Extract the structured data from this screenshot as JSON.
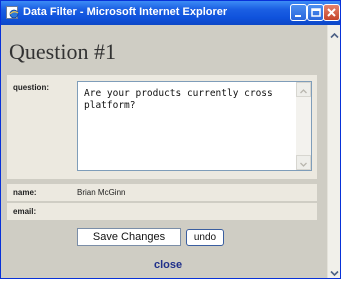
{
  "window": {
    "title": "Data Filter - Microsoft Internet Explorer",
    "icon": "ie-page-icon"
  },
  "page": {
    "heading": "Question #1"
  },
  "form": {
    "question_label": "question:",
    "question_value": "Are your products currently cross platform?",
    "name_label": "name:",
    "name_value": "Brian McGinn",
    "email_label": "email:",
    "email_value": ""
  },
  "actions": {
    "save_label": "Save Changes",
    "undo_label": "undo",
    "close_label": "close"
  },
  "colors": {
    "titlebar": "#0f52dc",
    "content_bg": "#cfcdc4",
    "row_bg": "#ece9e0",
    "link": "#1f2f8a"
  }
}
